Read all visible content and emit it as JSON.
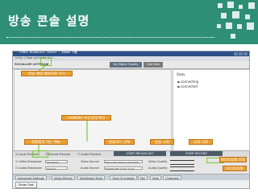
{
  "header": {
    "title": "방송 콘솔 설명"
  },
  "window": {
    "title": "VIMEO Broadcast Center - Adobe 키를",
    "url": "http://www.ustream.tv/..."
  },
  "app": {
    "logo": "SOCIALIZE USTREAM",
    "nav_tabs": [
      "Go Higher Quality",
      "Live Now"
    ]
  },
  "right_panel": {
    "heading": "Staty",
    "items": [
      "connecting",
      "connected"
    ]
  },
  "checkboxes": [
    "Local Preview",
    "Record Preview",
    "Audio Preview"
  ],
  "dark_buttons": [
    "START BROADCAST",
    "START RECORD"
  ],
  "controls": {
    "row1": {
      "label1": "Video Broadcast",
      "f1": "HD Ready",
      "label2": "Video Source",
      "f2": "Microsoft LifeCam VX-1000",
      "label3": "Video Quality"
    },
    "row2": {
      "label1": "Audio Broadcast",
      "f1": "Volume",
      "label2": "Audio Source",
      "f2": "Realtek HD Audio input",
      "label3": "Audio Quality"
    }
  },
  "tabs": [
    "Advanced Settings",
    "Video Effects",
    "Multibroad Tools",
    "Track & Indexes",
    "Poll",
    "Help",
    "Chatroom"
  ],
  "bottom_button": "Show Chat",
  "annotations": [
    "방송 채널 페이지로 가기",
    "CAMERA 수신상태 확인",
    "화질캡처 하는 메뉴",
    "방송모드 선택",
    "방송 시작",
    "녹화 시작",
    "비디오음질 조정",
    "오디오음질"
  ],
  "colors": {
    "header": "#2e8f76",
    "annotation": "#e8a032",
    "highlight": "#7cc63a"
  }
}
